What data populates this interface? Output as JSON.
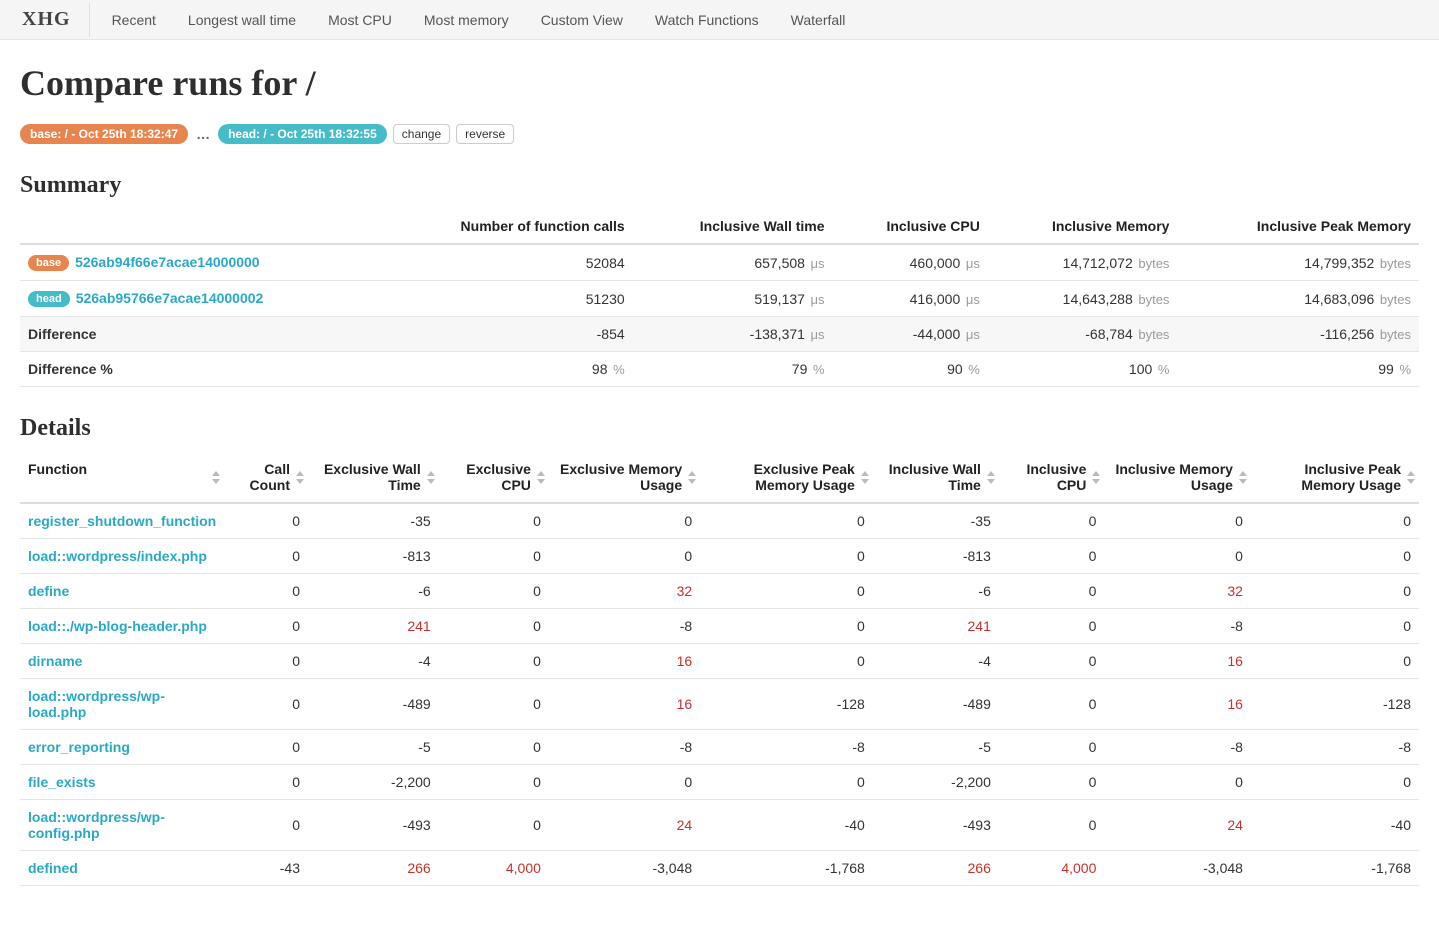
{
  "brand": "XHG",
  "nav": [
    "Recent",
    "Longest wall time",
    "Most CPU",
    "Most memory",
    "Custom View",
    "Watch Functions",
    "Waterfall"
  ],
  "page_title": "Compare runs for /",
  "pills": {
    "base": "base: / - Oct 25th 18:32:47",
    "head": "head: / - Oct 25th 18:32:55",
    "ellipsis": "…",
    "change": "change",
    "reverse": "reverse"
  },
  "sections": {
    "summary": "Summary",
    "details": "Details"
  },
  "summary": {
    "columns": [
      "",
      "Number of function calls",
      "Inclusive Wall time",
      "Inclusive CPU",
      "Inclusive Memory",
      "Inclusive Peak Memory"
    ],
    "units": [
      "",
      "",
      "μs",
      "μs",
      "bytes",
      "bytes"
    ],
    "rows": {
      "base": {
        "badge": "base",
        "hash": "526ab94f66e7acae14000000",
        "values": [
          "52084",
          "657,508",
          "460,000",
          "14,712,072",
          "14,799,352"
        ]
      },
      "head": {
        "badge": "head",
        "hash": "526ab95766e7acae14000002",
        "values": [
          "51230",
          "519,137",
          "416,000",
          "14,643,288",
          "14,683,096"
        ]
      },
      "diff": {
        "label": "Difference",
        "values": [
          "-854",
          "-138,371",
          "-44,000",
          "-68,784",
          "-116,256"
        ]
      },
      "diffpct": {
        "label": "Difference %",
        "unit": "%",
        "values": [
          "98",
          "79",
          "90",
          "100",
          "99"
        ]
      }
    }
  },
  "details": {
    "columns": [
      "Function",
      "Call Count",
      "Exclusive Wall Time",
      "Exclusive CPU",
      "Exclusive Memory Usage",
      "Exclusive Peak Memory Usage",
      "Inclusive Wall Time",
      "Inclusive CPU",
      "Inclusive Memory Usage",
      "Inclusive Peak Memory Usage"
    ],
    "rows": [
      {
        "fn": "register_shutdown_function",
        "v": [
          "0",
          "-35",
          "0",
          "0",
          "0",
          "-35",
          "0",
          "0",
          "0"
        ]
      },
      {
        "fn": "load::wordpress/index.php",
        "v": [
          "0",
          "-813",
          "0",
          "0",
          "0",
          "-813",
          "0",
          "0",
          "0"
        ]
      },
      {
        "fn": "define",
        "v": [
          "0",
          "-6",
          "0",
          "32",
          "0",
          "-6",
          "0",
          "32",
          "0"
        ]
      },
      {
        "fn": "load::./wp-blog-header.php",
        "v": [
          "0",
          "241",
          "0",
          "-8",
          "0",
          "241",
          "0",
          "-8",
          "0"
        ]
      },
      {
        "fn": "dirname",
        "v": [
          "0",
          "-4",
          "0",
          "16",
          "0",
          "-4",
          "0",
          "16",
          "0"
        ]
      },
      {
        "fn": "load::wordpress/wp-load.php",
        "v": [
          "0",
          "-489",
          "0",
          "16",
          "-128",
          "-489",
          "0",
          "16",
          "-128"
        ]
      },
      {
        "fn": "error_reporting",
        "v": [
          "0",
          "-5",
          "0",
          "-8",
          "-8",
          "-5",
          "0",
          "-8",
          "-8"
        ]
      },
      {
        "fn": "file_exists",
        "v": [
          "0",
          "-2,200",
          "0",
          "0",
          "0",
          "-2,200",
          "0",
          "0",
          "0"
        ]
      },
      {
        "fn": "load::wordpress/wp-config.php",
        "v": [
          "0",
          "-493",
          "0",
          "24",
          "-40",
          "-493",
          "0",
          "24",
          "-40"
        ]
      },
      {
        "fn": "defined",
        "v": [
          "-43",
          "266",
          "4,000",
          "-3,048",
          "-1,768",
          "266",
          "4,000",
          "-3,048",
          "-1,768"
        ]
      }
    ]
  }
}
